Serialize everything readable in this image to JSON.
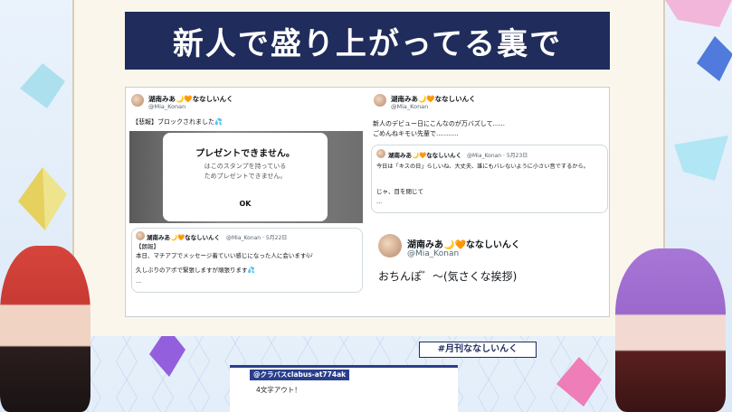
{
  "title": "新人で盛り上がってる裏で",
  "hashtag": "#月刊ななしいんく",
  "chat": {
    "name": "@クラバスclabus-at774ak",
    "message": "4文字アウト！"
  },
  "tweets": {
    "left": {
      "user_name": "湖南みあ🌙🧡ななしいんく",
      "handle": "@Mia_Konan",
      "text": "【悲報】ブロックされました💦",
      "modal": {
        "title": "プレゼントできません。",
        "message_line1": "はこのスタンプを持っている",
        "message_line2": "ためプレゼントできません。",
        "ok": "OK"
      },
      "quote": {
        "user_name": "湖南みあ🌙🧡ななしいんく",
        "handle_date": "@Mia_Konan · 5月22日",
        "line1": "【朗報】",
        "line2": "本日、マチアプでメッセージ着ていい感じになった人に会います🎶",
        "line3": "久しぶりのアポで緊張しますが頑張ります💦",
        "line4": "..."
      }
    },
    "right": {
      "user_name": "湖南みあ🌙🧡ななしいんく",
      "handle": "@Mia_Konan",
      "line1": "新人のデビュー日にこんなのが万バズして......",
      "line2": "ごめんねキモい先輩で...........",
      "quote": {
        "user_name": "湖南みあ🌙🧡ななしいんく",
        "handle_date": "@Mia_Konan · 5月23日",
        "line1": "今日は「キスの日」らしいね、大丈夫、誰にもバレないように小さい音でするから。",
        "line2": "じゃ、目を閉じて",
        "line3": "..."
      }
    },
    "zoom": {
      "user_name": "湖南みあ🌙🧡ななしいんく",
      "handle": "@Mia_Konan",
      "text": "おちんぽ゛～(気さくな挨拶)"
    }
  },
  "colors": {
    "title_bg": "#1f2c5c",
    "accent": "#2a3f8c",
    "verified": "#1d9bf0"
  }
}
